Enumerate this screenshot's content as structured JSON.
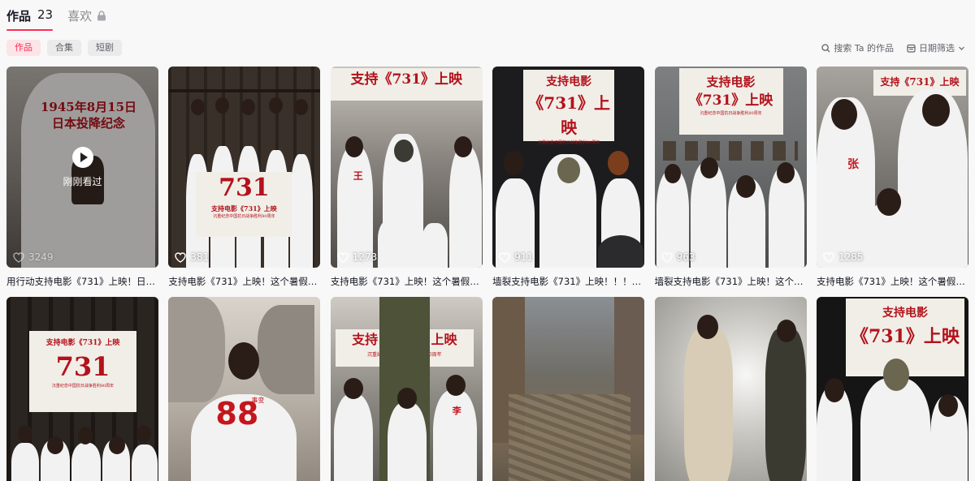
{
  "tabs": {
    "works_label": "作品",
    "works_count": "23",
    "likes_label": "喜欢"
  },
  "sub_tabs": [
    "作品",
    "合集",
    "短剧"
  ],
  "tools": {
    "search_label": "搜索 Ta 的作品",
    "date_filter_label": "日期筛选"
  },
  "accent_color": "#fe2c55",
  "videos": [
    {
      "caption": "用行动支持电影《731》上映！日本…",
      "likes": "3249",
      "overlay": "刚刚看过",
      "banner": "1945年8月15日 日本投降纪念"
    },
    {
      "caption": "支持电影《731》上映！这个暑假必…",
      "likes": "381",
      "banner": "731",
      "banner_sub": "支持电影《731》上映",
      "banner_note": "沉重纪念中国抗日战争胜利80周年"
    },
    {
      "caption": "支持电影《731》上映！这个暑假必…",
      "likes": "1273",
      "banner": "支持《731》上映",
      "shirt_mark": "王"
    },
    {
      "caption": "墙裂支持电影《731》上映！！！这…",
      "likes": "911",
      "banner": "支持电影",
      "banner_sub": "《731》上映",
      "banner_note": "沉重纪念中国抗日战争胜利80周年"
    },
    {
      "caption": "墙裂支持电影《731》上映！这个暑…",
      "likes": "963",
      "banner": "支持电影",
      "banner_sub": "《731》上映",
      "banner_note": "沉重纪念中国抗日战争胜利80周年"
    },
    {
      "caption": "支持电影《731》上映！这个暑假必…",
      "likes": "1285",
      "banner": "支持《731》上映",
      "shirt_mark": "张"
    },
    {
      "banner": "支持电影《731》上映",
      "banner_sub": "731",
      "banner_note": "沉重纪念中国抗日战争胜利80周年"
    },
    {
      "shirt_number": "88",
      "shirt_text": "事变"
    },
    {
      "banner": "支持《731》上映",
      "banner_note": "沉重纪念中国抗日战争胜利80周年",
      "shirt_mark": "李"
    },
    {},
    {},
    {
      "banner": "支持电影",
      "banner_sub": "《731》上映"
    }
  ]
}
